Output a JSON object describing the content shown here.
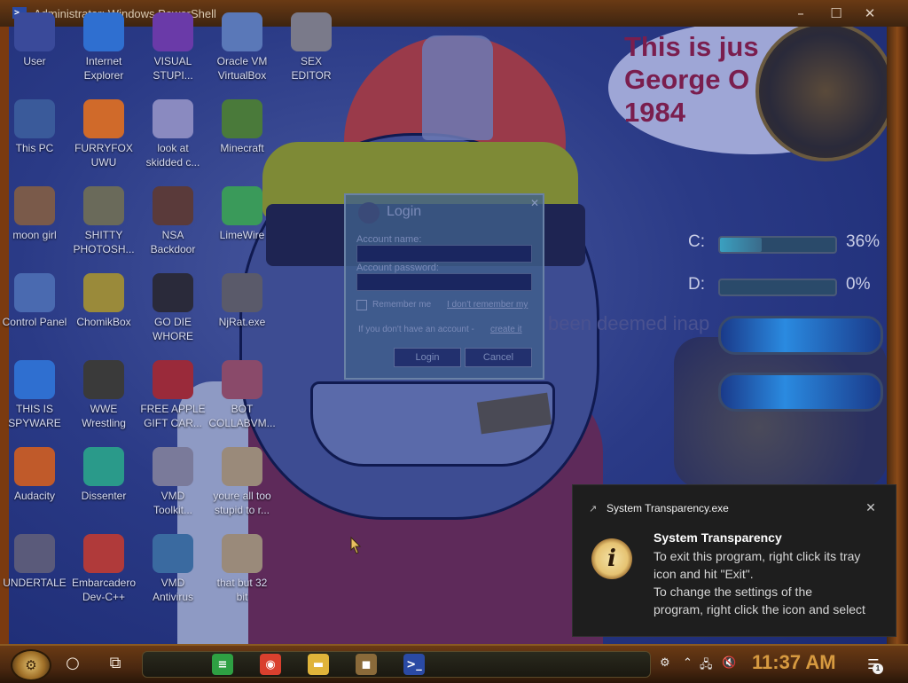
{
  "window": {
    "title": "Administrator: Windows PowerShell",
    "icon": "powershell-icon"
  },
  "wallpaper": {
    "speech_bubble": "This is jus\nGeorge O\n1984",
    "background_text": "been deemed inap",
    "drives": [
      {
        "letter": "C:",
        "percent": "36%",
        "fill": 0.36
      },
      {
        "letter": "D:",
        "percent": "0%",
        "fill": 0.0
      }
    ]
  },
  "desktop_icons": [
    {
      "label": "User",
      "icon": "user-folder-icon",
      "color": "#3a4a9a"
    },
    {
      "label": "Internet\nExplorer",
      "icon": "internet-explorer-icon",
      "color": "#2f6fd0"
    },
    {
      "label": "VISUAL\nSTUPI...",
      "icon": "visual-studio-icon",
      "color": "#6a3aa8"
    },
    {
      "label": "Oracle VM\nVirtualBox",
      "icon": "virtualbox-icon",
      "color": "#5a78b8"
    },
    {
      "label": "SEX\nEDITOR",
      "icon": "editor-icon",
      "color": "#7a7a8a"
    },
    {
      "label": "This PC",
      "icon": "this-pc-icon",
      "color": "#3a5a9a"
    },
    {
      "label": "FURRYFOX\nUWU",
      "icon": "firefox-icon",
      "color": "#d06a2a"
    },
    {
      "label": "look at\nskidded c...",
      "icon": "files-icon",
      "color": "#8a8ac0"
    },
    {
      "label": "Minecraft",
      "icon": "minecraft-icon",
      "color": "#4a7a3a"
    },
    {
      "label": "moon girl",
      "icon": "image-icon",
      "color": "#7a5a4a"
    },
    {
      "label": "SHITTY\nPHOTOSH...",
      "icon": "gimp-icon",
      "color": "#6a6a5a"
    },
    {
      "label": "NSA\nBackdoor",
      "icon": "backdoor-icon",
      "color": "#5a3a3a"
    },
    {
      "label": "LimeWire",
      "icon": "limewire-icon",
      "color": "#3a9a5a"
    },
    {
      "label": "Control Panel",
      "icon": "control-panel-icon",
      "color": "#4a6ab0"
    },
    {
      "label": "ChomikBox",
      "icon": "chomikbox-icon",
      "color": "#9a8a3a"
    },
    {
      "label": "GO DIE\nWHORE",
      "icon": "de-icon",
      "color": "#2a2a3a"
    },
    {
      "label": "NjRat.exe",
      "icon": "skull-icon",
      "color": "#5a5a6a"
    },
    {
      "label": "THIS IS\nSPYWARE",
      "icon": "chrome-icon",
      "color": "#2f6fd0"
    },
    {
      "label": "WWE\nWrestling",
      "icon": "tv-icon",
      "color": "#3a3a3a"
    },
    {
      "label": "FREE APPLE\nGIFT CAR...",
      "icon": "apple-icon",
      "color": "#9a2a3a"
    },
    {
      "label": "BOT\nCOLLABVM...",
      "icon": "monitor-icon",
      "color": "#8a4a6a"
    },
    {
      "label": "Audacity",
      "icon": "audacity-icon",
      "color": "#c05a2a"
    },
    {
      "label": "Dissenter",
      "icon": "dissenter-icon",
      "color": "#2a9a8a"
    },
    {
      "label": "VMD\nToolkit...",
      "icon": "toolkit-icon",
      "color": "#7a7a9a"
    },
    {
      "label": "youre all too\nstupid to r...",
      "icon": "portrait-icon",
      "color": "#9a8a7a"
    },
    {
      "label": "UNDERTALE",
      "icon": "unity-icon",
      "color": "#5a5a7a"
    },
    {
      "label": "Embarcadero\nDev-C++",
      "icon": "devcpp-icon",
      "color": "#b03a3a"
    },
    {
      "label": "VMD\nAntivirus",
      "icon": "shield-icon",
      "color": "#3a6aa0"
    },
    {
      "label": "that but 32\nbit",
      "icon": "portrait-icon",
      "color": "#9a8a7a"
    }
  ],
  "login_dialog": {
    "title": "Login",
    "account_label": "Account name:",
    "password_label": "Account password:",
    "remember_label": "Remember me",
    "forgot_link": "I don't remember my",
    "no_account_text": "If you don't have an account -",
    "create_link": "create it",
    "login_button": "Login",
    "cancel_button": "Cancel"
  },
  "toast": {
    "app_name": "System Transparency.exe",
    "heading": "System Transparency",
    "body": "To exit this program, right click its tray\nicon and hit \"Exit\".\nTo change the settings of the\nprogram, right click the icon and select",
    "close_icon": "close-icon",
    "info_icon": "info-icon"
  },
  "taskbar": {
    "clock": "11:37 AM",
    "notification_count": "1",
    "pinned_apps": [
      {
        "name": "notes-app-icon",
        "glyph": "≡",
        "color": "#2ea043"
      },
      {
        "name": "chrome-icon",
        "glyph": "◉",
        "color": "#d9402e"
      },
      {
        "name": "file-explorer-icon",
        "glyph": "▬",
        "color": "#e0b43a"
      },
      {
        "name": "chomikbox-icon",
        "glyph": "◼",
        "color": "#8a6a3a"
      },
      {
        "name": "powershell-icon",
        "glyph": ">_",
        "color": "#2a4aa4"
      }
    ]
  },
  "colors": {
    "toast_bg": "#1e1e1e",
    "clock": "#d79a40",
    "taskbar": "#4a2810"
  }
}
